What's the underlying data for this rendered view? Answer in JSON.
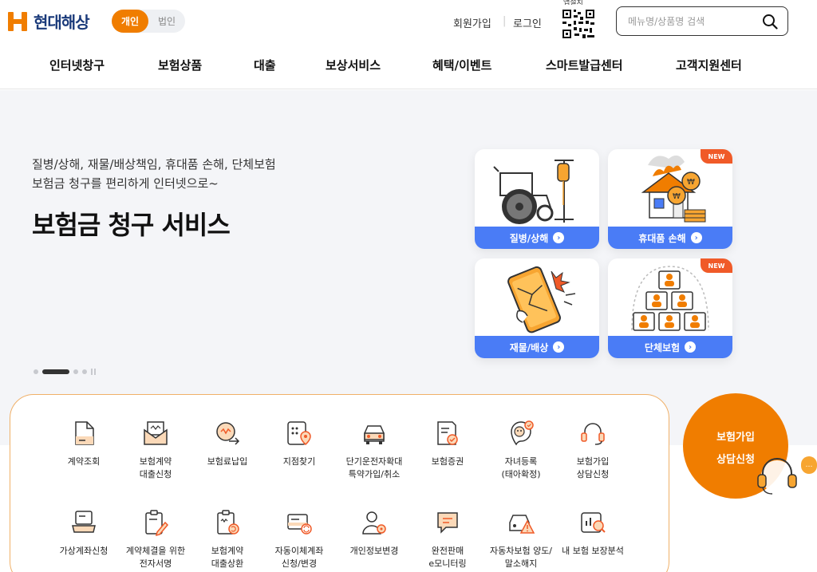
{
  "brand": {
    "name": "현대해상",
    "color": "#f07d00",
    "navy": "#1a3a7a"
  },
  "segment": {
    "active": "개인",
    "inactive": "법인"
  },
  "utility": {
    "join": "회원가입",
    "login": "로그인",
    "qr_label": "앱설치"
  },
  "search": {
    "placeholder": "메뉴명/상품명 검색",
    "icon": "search-icon"
  },
  "gnb": [
    {
      "label": "인터넷창구"
    },
    {
      "label": "보험상품"
    },
    {
      "label": "대출"
    },
    {
      "label": "보상서비스"
    },
    {
      "label": "혜택/이벤트"
    },
    {
      "label": "스마트발급센터"
    },
    {
      "label": "고객지원센터"
    }
  ],
  "hero": {
    "sub1": "질병/상해, 재물/배상책임, 휴대품 손해, 단체보험",
    "sub2": "보험금 청구를 편리하게 인터넷으로~",
    "title": "보험금 청구 서비스",
    "slide_total": 4,
    "slide_active": 2
  },
  "cards": [
    {
      "label": "질병/상해",
      "new": false,
      "icon": "wheelchair-iv-icon"
    },
    {
      "label": "휴대품 손해",
      "new": true,
      "badge": "NEW",
      "icon": "burning-house-coins-icon"
    },
    {
      "label": "재물/배상",
      "new": false,
      "icon": "broken-phone-icon"
    },
    {
      "label": "단체보험",
      "new": true,
      "badge": "NEW",
      "icon": "group-people-icon"
    }
  ],
  "quick_menu": [
    {
      "label1": "계약조회",
      "label2": "",
      "icon": "document-icon"
    },
    {
      "label1": "보험계약",
      "label2": "대출신청",
      "icon": "envelope-money-icon"
    },
    {
      "label1": "보험료납입",
      "label2": "",
      "icon": "coin-pay-icon"
    },
    {
      "label1": "지점찾기",
      "label2": "",
      "icon": "map-pin-icon"
    },
    {
      "label1": "단기운전자확대",
      "label2": "특약가입/취소",
      "icon": "car-icon"
    },
    {
      "label1": "보험증권",
      "label2": "",
      "icon": "certificate-icon"
    },
    {
      "label1": "자녀등록",
      "label2": "(태아확정)",
      "icon": "baby-icon"
    },
    {
      "label1": "보험가입",
      "label2": "상담신청",
      "icon": "headset-icon"
    },
    {
      "label1": "가상계좌신청",
      "label2": "",
      "icon": "virtual-account-icon"
    },
    {
      "label1": "계약체결을 위한",
      "label2": "전자서명",
      "icon": "e-signature-icon"
    },
    {
      "label1": "보험계약",
      "label2": "대출상환",
      "icon": "loan-repay-icon"
    },
    {
      "label1": "자동이체계좌",
      "label2": "신청/변경",
      "icon": "auto-transfer-icon"
    },
    {
      "label1": "개인정보변경",
      "label2": "",
      "icon": "user-settings-icon"
    },
    {
      "label1": "완전판매",
      "label2": "e모니터링",
      "icon": "monitoring-chat-icon"
    },
    {
      "label1": "자동차보험 양도/",
      "label2": "말소해지",
      "icon": "car-warning-icon"
    },
    {
      "label1": "내 보험 보장분석",
      "label2": "",
      "icon": "analysis-icon"
    }
  ],
  "consult": {
    "line1": "보험가입",
    "line2": "상담신청"
  },
  "colors": {
    "accent_blue": "#4a7cf6",
    "new_badge": "#f05a28",
    "hero_bg": "#f4f5f8"
  }
}
